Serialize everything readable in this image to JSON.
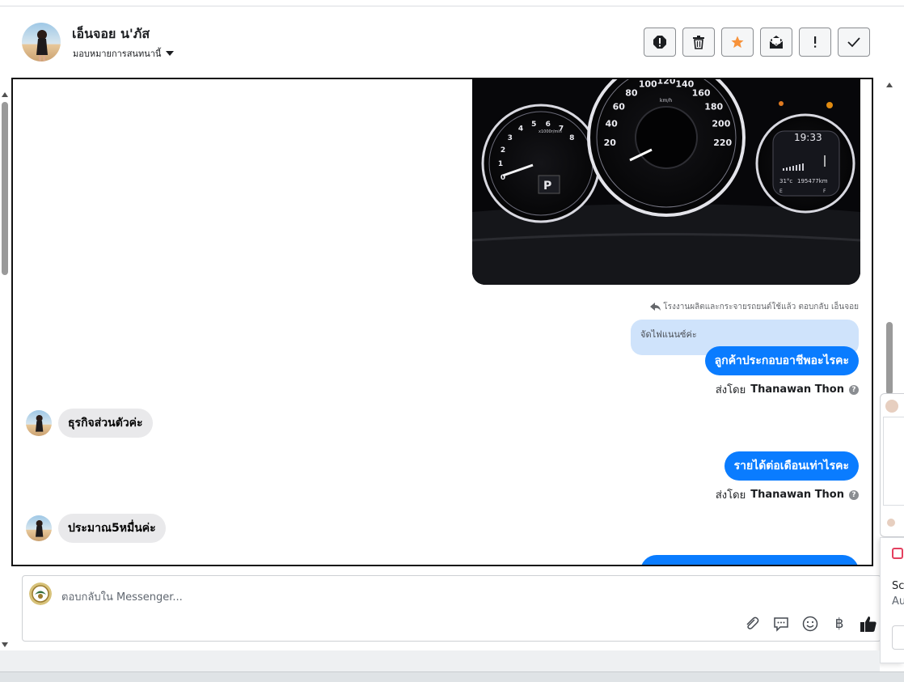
{
  "header": {
    "contact_name": "เอ็นจอย น'ภัส",
    "assign_label": "มอบหมายการสนทนานี้",
    "actions": [
      {
        "name": "report-button",
        "icon": "exclamation-circle-icon"
      },
      {
        "name": "delete-button",
        "icon": "trash-icon"
      },
      {
        "name": "star-button",
        "icon": "star-icon"
      },
      {
        "name": "mark-unread-button",
        "icon": "envelope-open-icon"
      },
      {
        "name": "follow-up-button",
        "icon": "exclamation-icon"
      },
      {
        "name": "mark-done-button",
        "icon": "check-icon"
      }
    ]
  },
  "conversation": {
    "photo": {
      "speed_marks": [
        "20",
        "40",
        "60",
        "80",
        "100",
        "120",
        "140",
        "160",
        "180",
        "200",
        "220"
      ],
      "speed_unit": "km/h",
      "rpm_marks": [
        "0",
        "1",
        "2",
        "3",
        "4",
        "5",
        "6",
        "7",
        "8"
      ],
      "rpm_unit": "x1000r/min",
      "gear": "P",
      "clock": "19:33",
      "temperature": "31°c",
      "odometer": "195477km",
      "fuel_empty": "E",
      "fuel_full": "F"
    },
    "reply_meta": "โรงงานผลิตและกระจายรถยนต์ใช้แล้ว ตอบกลับ เอ็นจอย",
    "quoted_text": "จัดไฟแนนซ์ค่ะ",
    "messages": [
      {
        "direction": "out",
        "text": "ลูกค้าประกอบอาชีพอะไรคะ",
        "sent_by_label": "ส่งโดย",
        "sender": "Thanawan Thon"
      },
      {
        "direction": "in",
        "text": "ธุรกิจส่วนตัวค่ะ"
      },
      {
        "direction": "out",
        "text": "รายได้ต่อเดือนเท่าไรคะ",
        "sent_by_label": "ส่งโดย",
        "sender": "Thanawan Thon"
      },
      {
        "direction": "in",
        "text": "ประมาณ5หมื่นค่ะ"
      }
    ],
    "help_glyph": "?"
  },
  "composer": {
    "placeholder": "ตอบกลับใน Messenger...",
    "tools": [
      {
        "name": "attach-button",
        "icon": "paperclip-icon"
      },
      {
        "name": "saved-replies-button",
        "icon": "chat-bubble-icon"
      },
      {
        "name": "emoji-button",
        "icon": "smiley-icon"
      },
      {
        "name": "payment-button",
        "icon": "baht-icon",
        "glyph": "฿"
      },
      {
        "name": "like-button",
        "icon": "thumbs-up-icon"
      }
    ]
  },
  "side_card": {
    "line1": "Sc",
    "line2": "Au"
  },
  "colors": {
    "outgoing_bubble": "#0a7cff",
    "incoming_bubble": "#e9e9eb",
    "quoted_bubble": "#cfe3fb",
    "star": "#f7923a"
  }
}
